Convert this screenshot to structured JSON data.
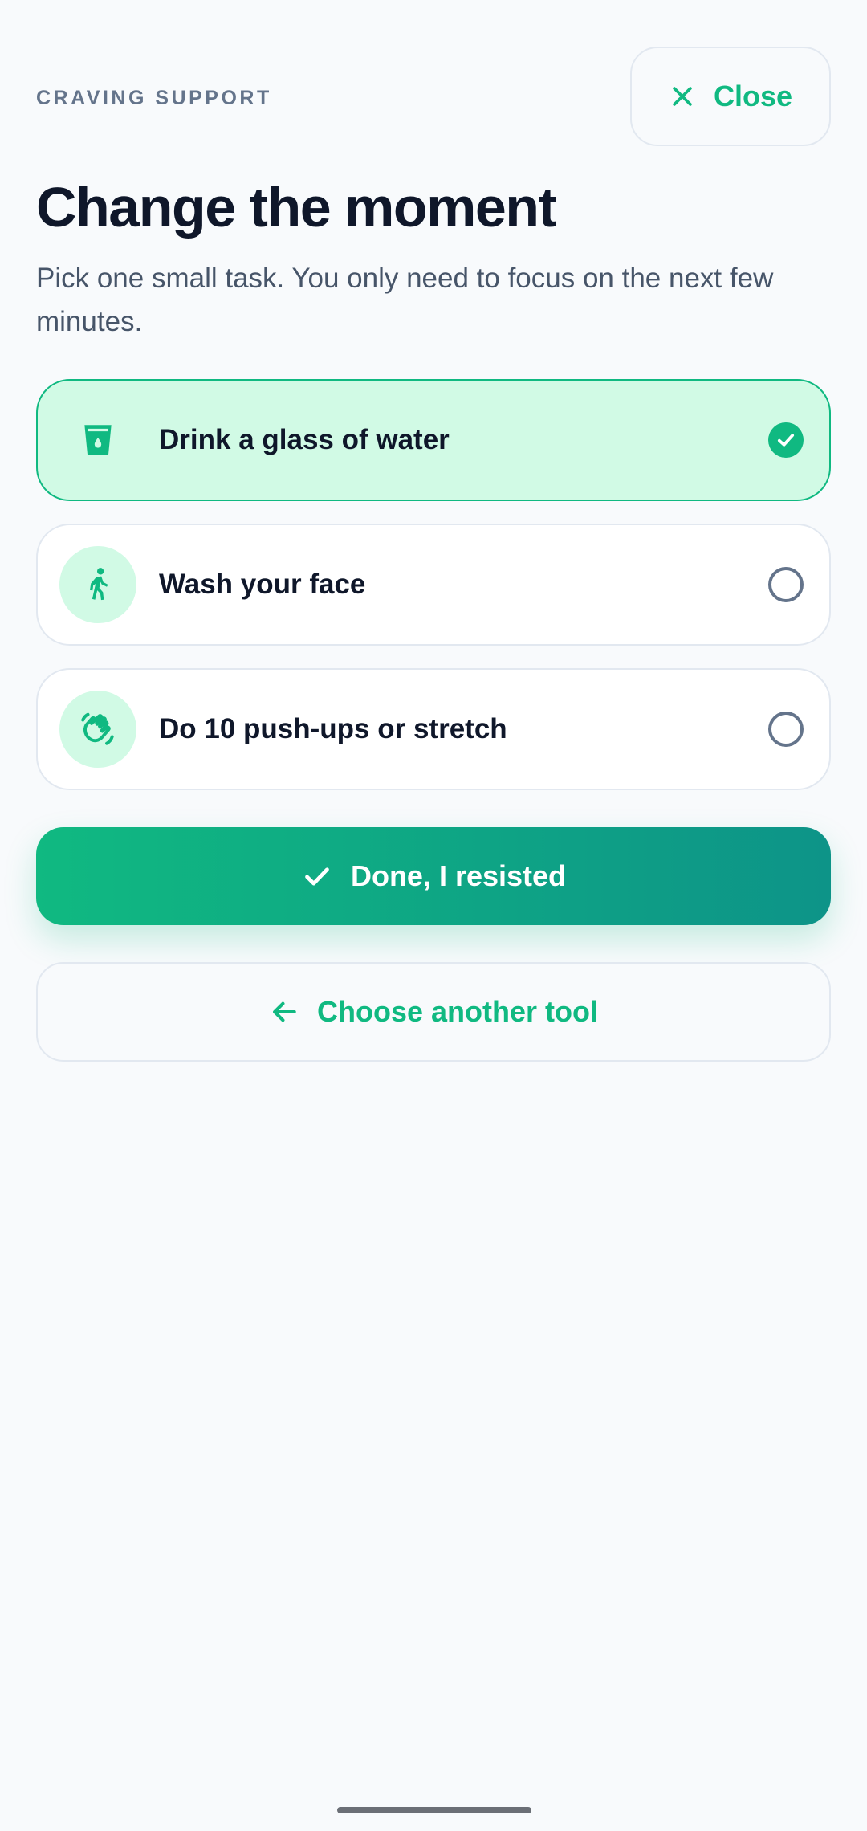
{
  "header": {
    "eyebrow": "CRAVING SUPPORT",
    "close_label": "Close",
    "close_icon": "close-icon"
  },
  "title": "Change the moment",
  "subtitle": "Pick one small task. You only need to focus on the next few minutes.",
  "tasks": [
    {
      "label": "Drink a glass of water",
      "icon": "water-glass-icon",
      "selected": true
    },
    {
      "label": "Wash your face",
      "icon": "walking-person-icon",
      "selected": false
    },
    {
      "label": "Do 10 push-ups or stretch",
      "icon": "hands-icon",
      "selected": false
    }
  ],
  "actions": {
    "done_label": "Done, I resisted",
    "back_label": "Choose another tool"
  },
  "colors": {
    "accent": "#10b981",
    "accent_dark": "#0d9488",
    "selected_bg": "#d1fae5",
    "title": "#0f172a",
    "muted": "#64748b"
  }
}
